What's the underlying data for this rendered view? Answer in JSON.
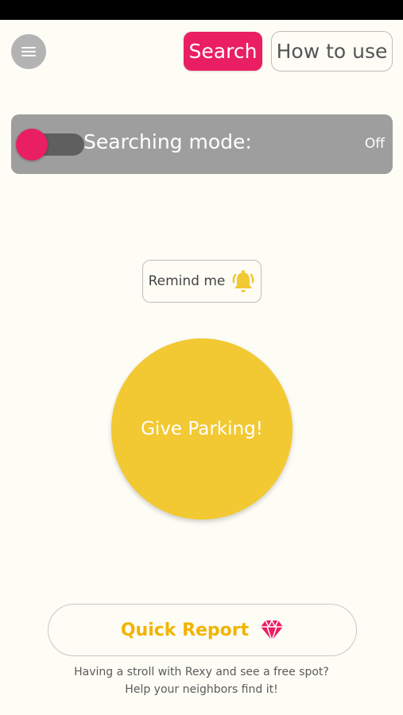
{
  "header": {
    "menu_icon": "hamburger-menu-icon",
    "tabs": [
      {
        "label": "Search",
        "active": true,
        "color": "#ea1e63"
      },
      {
        "label": "How to use",
        "active": false
      }
    ]
  },
  "searching_mode": {
    "label": "Searching mode:",
    "state": "Off",
    "toggle_color": "#ea1e63"
  },
  "remind": {
    "label": "Remind me",
    "icon": "bell-icon",
    "icon_color": "#f2c932"
  },
  "give_parking": {
    "label": "Give Parking!",
    "color": "#f2c932"
  },
  "quick_report": {
    "label": "Quick Report",
    "icon": "gem-icon",
    "label_color": "#f2b400",
    "icon_color": "#ea1e63"
  },
  "footer": {
    "line1": "Having a stroll with Rexy and see a free spot?",
    "line2": "Help your neighbors find it!"
  }
}
